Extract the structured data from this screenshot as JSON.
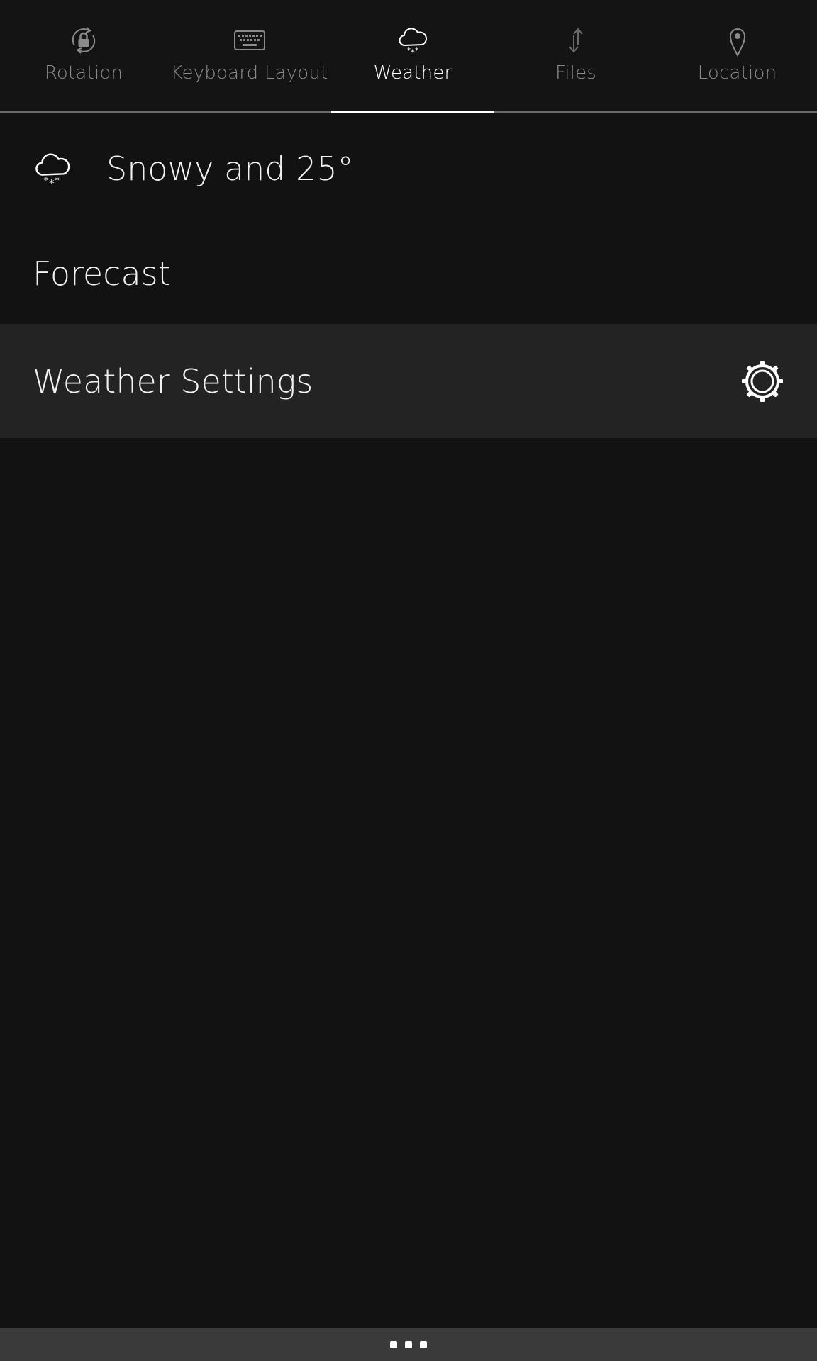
{
  "tabs": [
    {
      "label": "Rotation",
      "icon": "rotation-lock-icon",
      "active": false
    },
    {
      "label": "Keyboard Layout",
      "icon": "keyboard-icon",
      "active": false
    },
    {
      "label": "Weather",
      "icon": "snow-cloud-icon",
      "active": true
    },
    {
      "label": "Files",
      "icon": "transfer-arrows-icon",
      "active": false
    },
    {
      "label": "Location",
      "icon": "location-pin-icon",
      "active": false
    }
  ],
  "weather": {
    "current_icon": "snow-cloud-icon",
    "current_text": "Snowy and 25°",
    "forecast_label": "Forecast",
    "settings_label": "Weather Settings",
    "settings_icon": "gear-icon"
  },
  "bottom_bar": {
    "icon": "more-dots-icon"
  },
  "colors": {
    "background": "#121212",
    "settings_row": "#232323",
    "active_text": "#ffffff",
    "inactive_text": "#8a8a8a",
    "bottom_bar": "#3a3a3a"
  }
}
